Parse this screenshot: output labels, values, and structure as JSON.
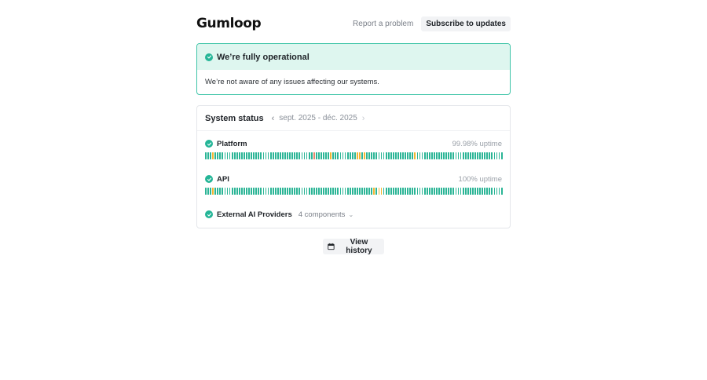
{
  "header": {
    "logo_text": "Gumloop",
    "report_label": "Report a problem",
    "subscribe_label": "Subscribe to updates"
  },
  "banner": {
    "title": "We’re fully operational",
    "message": "We’re not aware of any issues affecting our systems."
  },
  "system_status": {
    "title": "System status",
    "date_range": "sept. 2025 - déc. 2025",
    "components": [
      {
        "name": "Platform",
        "uptime": "99.98% uptime",
        "status": "operational",
        "days": [
          "u",
          "u",
          "u",
          "d",
          "u",
          "u",
          "u",
          "u",
          "u",
          "u",
          "u",
          "u",
          "u",
          "u",
          "u",
          "u",
          "u",
          "u",
          "u",
          "u",
          "u",
          "u",
          "u",
          "u",
          "u",
          "u",
          "u",
          "u",
          "u",
          "u",
          "u",
          "u",
          "u",
          "u",
          "u",
          "u",
          "u",
          "u",
          "u",
          "u",
          "u",
          "u",
          "u",
          "u",
          "u",
          "m",
          "u",
          "u",
          "u",
          "u",
          "u",
          "u",
          "d",
          "u",
          "u",
          "u",
          "u",
          "u",
          "u",
          "u",
          "u",
          "u",
          "u",
          "d",
          "d",
          "u",
          "d",
          "u",
          "u",
          "u",
          "u",
          "u",
          "u",
          "u",
          "u",
          "u",
          "u",
          "u",
          "u",
          "u",
          "u",
          "u",
          "u",
          "u",
          "u",
          "u",
          "u",
          "d",
          "u",
          "u",
          "u",
          "u",
          "u",
          "u",
          "u",
          "u",
          "u",
          "u",
          "u",
          "u",
          "u",
          "u",
          "u",
          "u",
          "u",
          "u",
          "u",
          "u",
          "u",
          "u",
          "u",
          "u",
          "u",
          "u",
          "u",
          "u",
          "u",
          "u",
          "u",
          "u",
          "u",
          "u",
          "u",
          "u"
        ]
      },
      {
        "name": "API",
        "uptime": "100% uptime",
        "status": "operational",
        "days": [
          "u",
          "u",
          "u",
          "d",
          "u",
          "u",
          "u",
          "u",
          "u",
          "u",
          "u",
          "u",
          "u",
          "u",
          "u",
          "u",
          "u",
          "u",
          "u",
          "u",
          "u",
          "u",
          "u",
          "u",
          "u",
          "u",
          "u",
          "u",
          "u",
          "u",
          "u",
          "u",
          "u",
          "u",
          "u",
          "u",
          "u",
          "u",
          "u",
          "u",
          "u",
          "u",
          "u",
          "u",
          "u",
          "u",
          "u",
          "u",
          "u",
          "u",
          "u",
          "u",
          "u",
          "u",
          "u",
          "u",
          "u",
          "u",
          "u",
          "u",
          "u",
          "u",
          "u",
          "u",
          "u",
          "u",
          "u",
          "u",
          "u",
          "u",
          "d",
          "u",
          "d",
          "d",
          "u",
          "u",
          "u",
          "u",
          "u",
          "u",
          "u",
          "u",
          "u",
          "u",
          "u",
          "u",
          "u",
          "u",
          "u",
          "u",
          "u",
          "u",
          "u",
          "u",
          "u",
          "u",
          "u",
          "u",
          "u",
          "u",
          "u",
          "u",
          "u",
          "u",
          "u",
          "u",
          "u",
          "u",
          "u",
          "u",
          "u",
          "u",
          "u",
          "u",
          "u",
          "u",
          "u",
          "u",
          "u",
          "u",
          "u",
          "u",
          "u",
          "u"
        ]
      },
      {
        "name": "External AI Providers",
        "status": "operational",
        "components_label": "4 components"
      }
    ]
  },
  "footer": {
    "history_label": "View history"
  },
  "colors": {
    "up": "#2bb596",
    "degraded": "#f2b531",
    "minor": "#e8866b",
    "accent": "#3ec4a7"
  }
}
